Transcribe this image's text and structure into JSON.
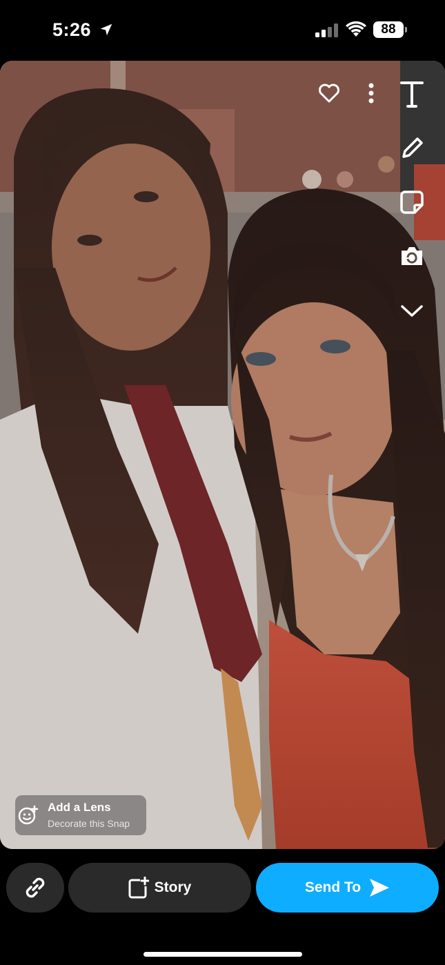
{
  "status_bar": {
    "time": "5:26",
    "battery": "88",
    "icons": [
      "location-arrow-icon",
      "cellular-signal-icon",
      "wifi-icon",
      "battery-icon"
    ]
  },
  "photo": {
    "description_icon": "snap-photo"
  },
  "tools": {
    "icons": [
      "heart-icon",
      "more-options-icon",
      "text-tool-icon",
      "pencil-icon",
      "sticker-icon",
      "lens-swap-icon",
      "chevron-down-icon"
    ]
  },
  "lens_chip": {
    "title": "Add a Lens",
    "subtitle": "Decorate this Snap",
    "icon": "smiley-plus-icon"
  },
  "bottom_bar": {
    "link_icon": "link-icon",
    "story_label": "Story",
    "story_icon": "story-add-icon",
    "send_label": "Send To",
    "send_icon": "send-arrow-icon"
  },
  "colors": {
    "send_button": "#0fadff",
    "dark_button": "#2a2a2a",
    "background": "#000000"
  }
}
